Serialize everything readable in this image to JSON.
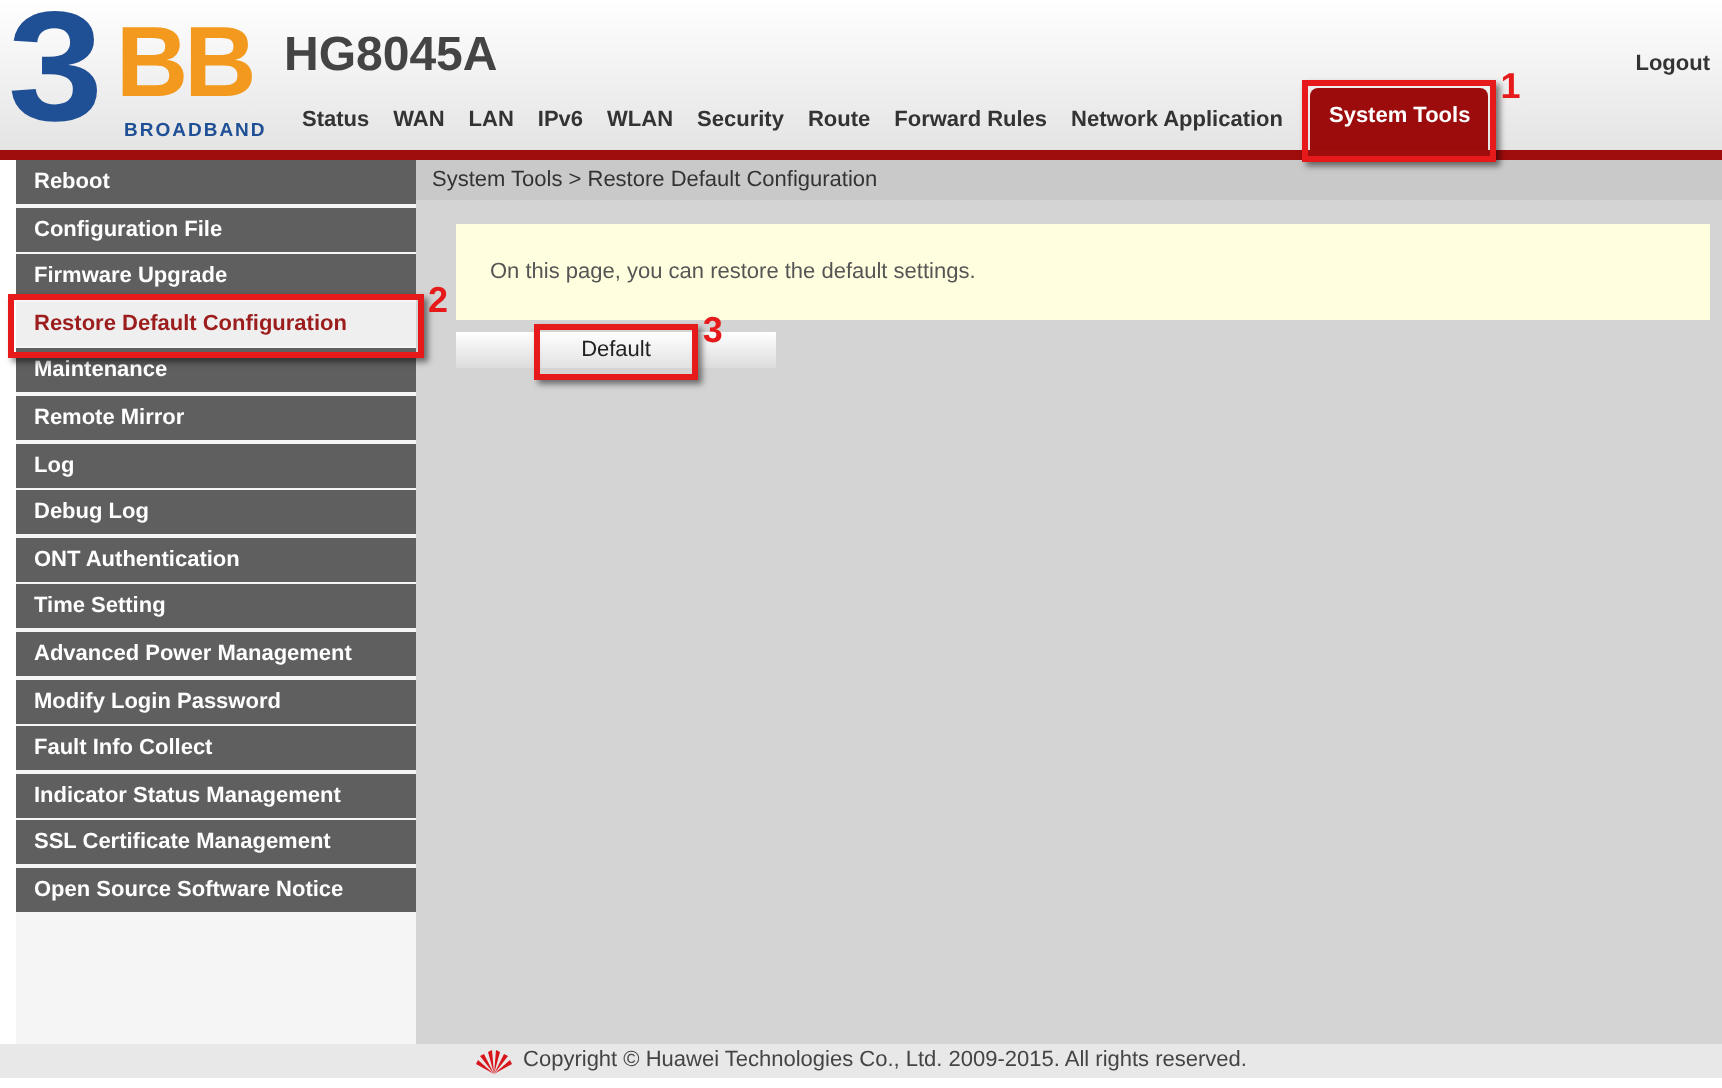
{
  "logo": {
    "numeral": "3",
    "letters": "BB",
    "tagline": "BROADBAND"
  },
  "device": "HG8045A",
  "logout": "Logout",
  "nav": [
    {
      "label": "Status",
      "selected": false
    },
    {
      "label": "WAN",
      "selected": false
    },
    {
      "label": "LAN",
      "selected": false
    },
    {
      "label": "IPv6",
      "selected": false
    },
    {
      "label": "WLAN",
      "selected": false
    },
    {
      "label": "Security",
      "selected": false
    },
    {
      "label": "Route",
      "selected": false
    },
    {
      "label": "Forward Rules",
      "selected": false
    },
    {
      "label": "Network Application",
      "selected": false
    },
    {
      "label": "System Tools",
      "selected": true,
      "annotation": "1"
    }
  ],
  "sidebar": {
    "items": [
      {
        "label": "Reboot",
        "selected": false
      },
      {
        "label": "Configuration File",
        "selected": false
      },
      {
        "label": "Firmware Upgrade",
        "selected": false
      },
      {
        "label": "Restore Default Configuration",
        "selected": true,
        "annotation": "2"
      },
      {
        "label": "Maintenance",
        "selected": false
      },
      {
        "label": "Remote Mirror",
        "selected": false
      },
      {
        "label": "Log",
        "selected": false
      },
      {
        "label": "Debug Log",
        "selected": false
      },
      {
        "label": "ONT Authentication",
        "selected": false
      },
      {
        "label": "Time Setting",
        "selected": false
      },
      {
        "label": "Advanced Power Management",
        "selected": false
      },
      {
        "label": "Modify Login Password",
        "selected": false
      },
      {
        "label": "Fault Info Collect",
        "selected": false
      },
      {
        "label": "Indicator Status Management",
        "selected": false
      },
      {
        "label": "SSL Certificate Management",
        "selected": false
      },
      {
        "label": "Open Source Software Notice",
        "selected": false
      }
    ]
  },
  "breadcrumb": "System Tools > Restore Default Configuration",
  "notice": "On this page, you can restore the default settings.",
  "button": {
    "label": "Default",
    "annotation": "3"
  },
  "footer": "Copyright © Huawei Technologies Co., Ltd. 2009-2015. All rights reserved."
}
